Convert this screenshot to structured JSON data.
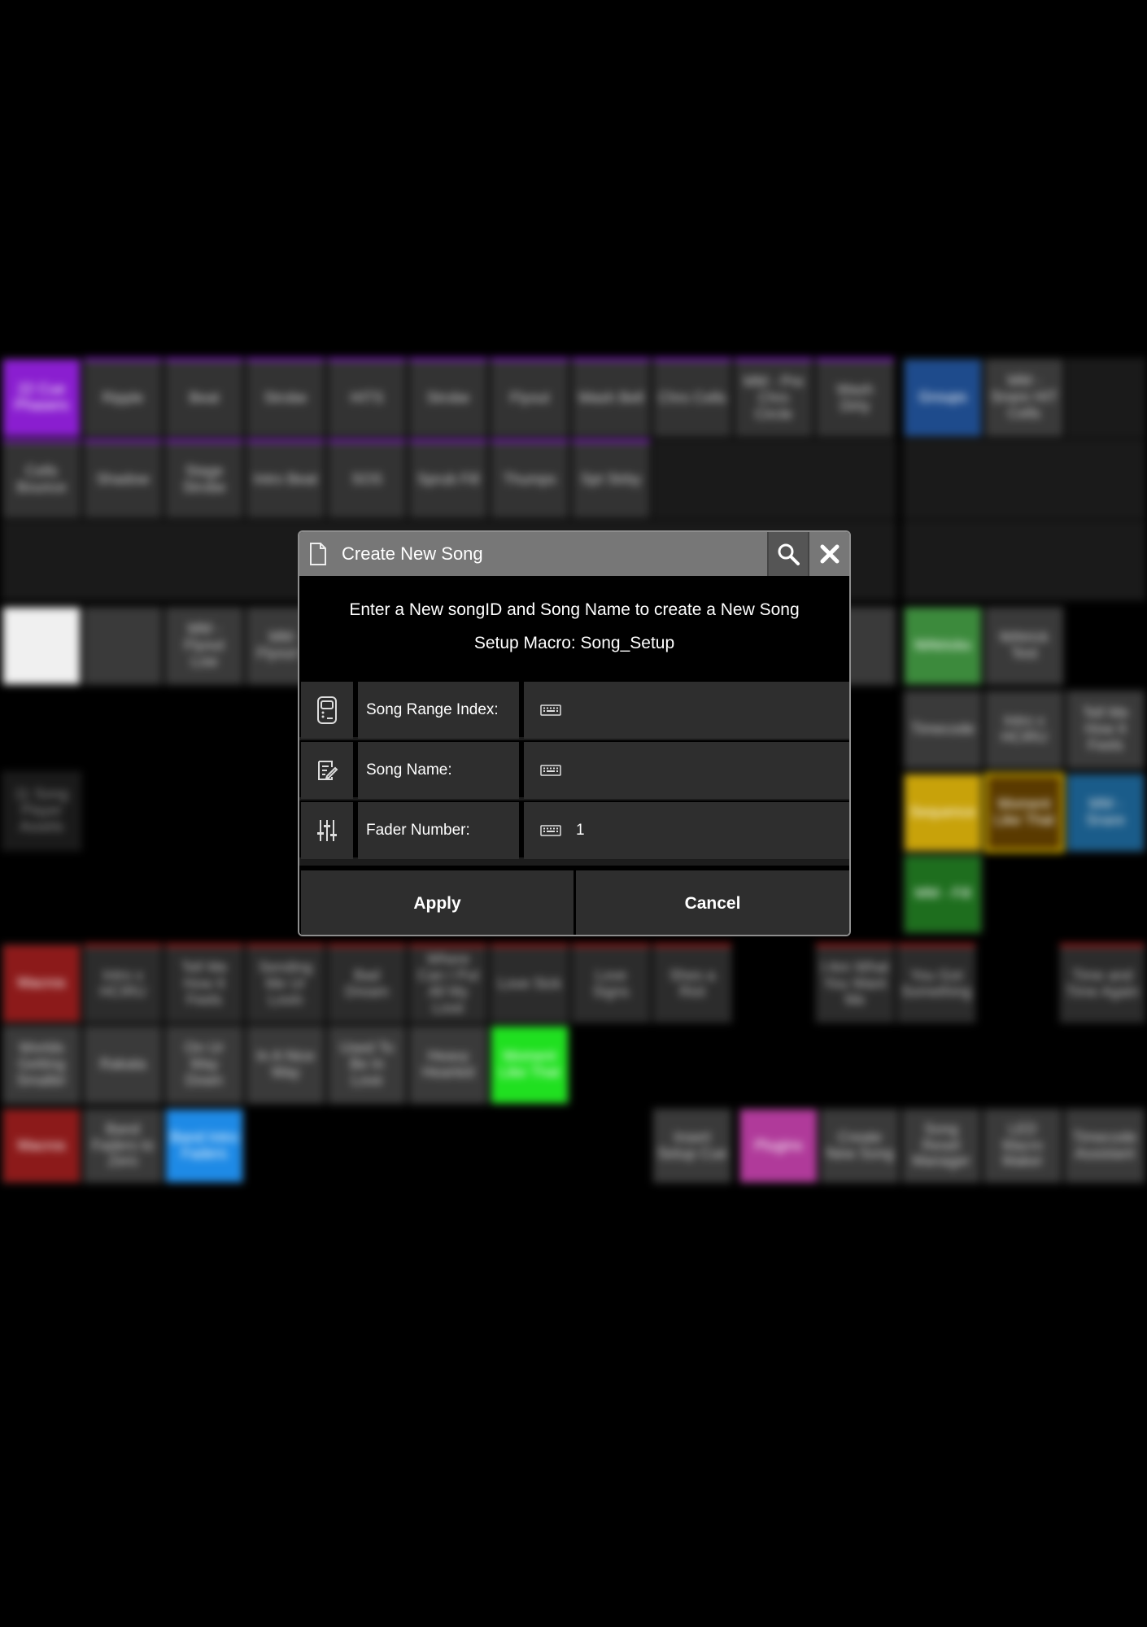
{
  "dialog": {
    "title": "Create New Song",
    "message_line1": "Enter a New songID and Song Name to create a New Song",
    "message_line2": "Setup Macro: Song_Setup",
    "fields": [
      {
        "label": "Song Range Index:",
        "value": "",
        "icon": "device-icon"
      },
      {
        "label": "Song Name:",
        "value": "",
        "icon": "edit-note-icon"
      },
      {
        "label": "Fader Number:",
        "value": "1",
        "icon": "sliders-icon"
      }
    ],
    "apply_label": "Apply",
    "cancel_label": "Cancel"
  },
  "background": {
    "groups_label": "Groups",
    "matricks_label": "MAtricks",
    "timecode_label": "Timecode",
    "sequence_label": "Sequence",
    "macros_label": "Macros",
    "plugins_label": "Plugins",
    "macro_items": [
      "Intro x HCIRU",
      "Tell Me How It Feels",
      "Sending Me Ur Lovin",
      "Bad Dream",
      "Where Can I Put All My Love",
      "Love Sick",
      "Love Signs",
      "Shes a Riot",
      "I Am What You Want Me",
      "You Got Something",
      "Time and Time Again"
    ],
    "macro_items_row2": [
      "Worlds Getting Smaller",
      "Rakata",
      "On Ur Way Down",
      "In A Nice Way",
      "Used To Be In Love",
      "Heavy Hearted",
      "Moment Like That"
    ],
    "plugin_items": [
      "Create New Song",
      "Song Reset Manager",
      "LED Macro Maker",
      "Timecode Assistant"
    ],
    "sequence_items": [
      "Moment Like That",
      "MM - Snare"
    ],
    "timecode_items": [
      "Intro x HCIRU",
      "Tell Me How It Feels"
    ],
    "group_items": [
      "MM - Snare HIT Cells"
    ],
    "matricks_items": [
      "MAtrick Test"
    ],
    "phaser_title": "22 Cue Phasers",
    "phaser_items": [
      "Ripple",
      "Beat",
      "Strobe",
      "HITS",
      "Strobe",
      "Flyout",
      "Wash Bell",
      "Chrs Cells",
      "MM - Pre Chrs Circle",
      "Wash Dirty"
    ],
    "phaser_items_row2": [
      "Cells Bounce",
      "Shadow",
      "Stage Strobe",
      "Intro Beat",
      "SOS",
      "Sprub Fill",
      "Thumps",
      "Spt Strby"
    ],
    "macro2_items": [
      "Band Faders to Zero",
      "Band Intro Faders",
      "Insert Setup Cue"
    ],
    "song_player_assets": "11 Song Player Assets",
    "mm_fill": "MM - Fill",
    "flyout_items": [
      "MM - Flyout Low",
      "MM - Flyout Hi"
    ]
  }
}
